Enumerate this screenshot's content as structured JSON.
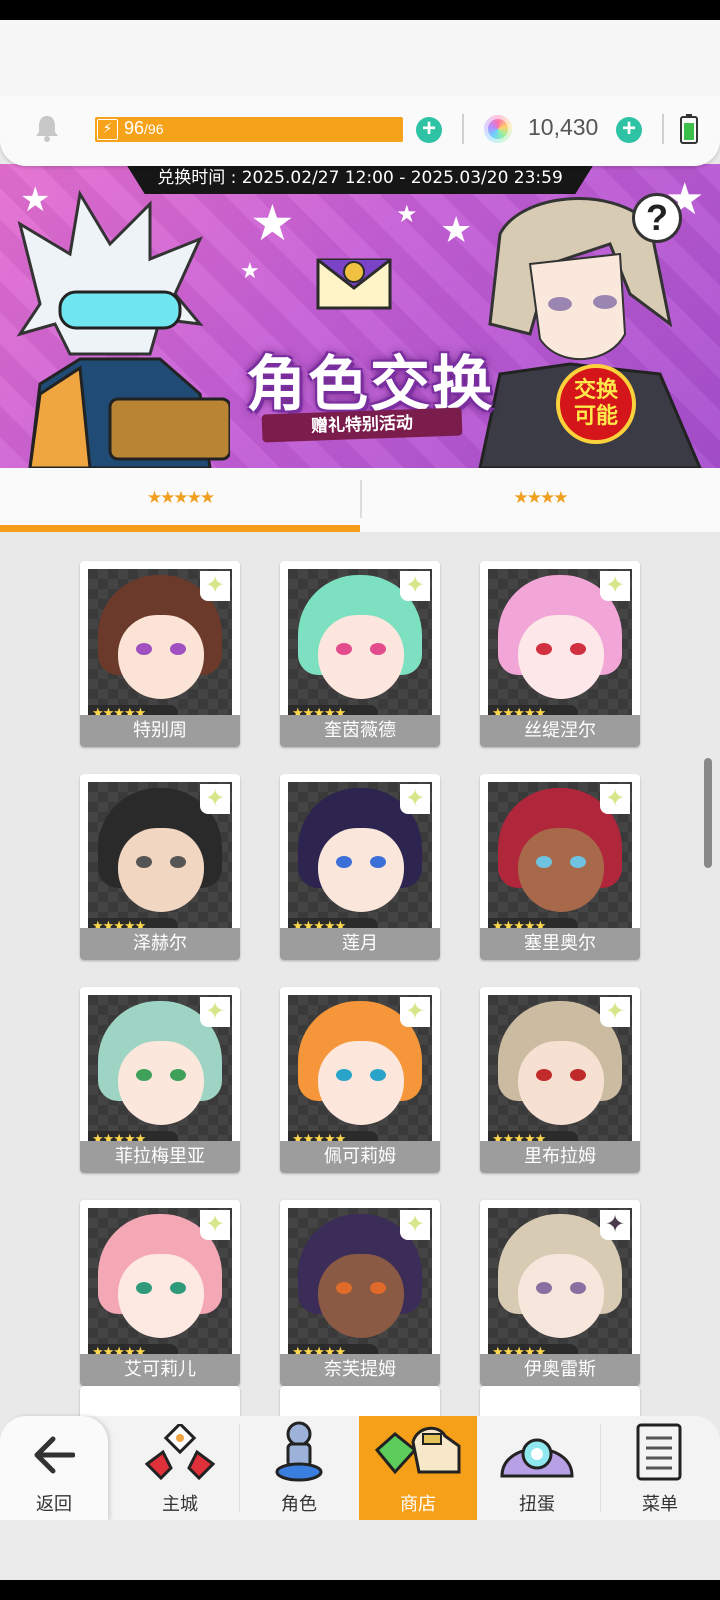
{
  "resources": {
    "energy_current": "96",
    "energy_max": "/96",
    "gems": "10,430",
    "plus": "+"
  },
  "banner": {
    "exchange_time": "兑换时间 : 2025.02/27 12:00 - 2025.03/20 23:59",
    "title": "角色交换",
    "subtitle": "赠礼特别活动",
    "badge_line1": "交换",
    "badge_line2": "可能",
    "help": "?"
  },
  "tabs": [
    {
      "label": "★★★★★",
      "active": true
    },
    {
      "label": "★★★★",
      "active": false
    }
  ],
  "characters": [
    {
      "name": "特别周",
      "stars": "★★★★★",
      "hair": "#6b3a2a",
      "face": "#fbe3d6",
      "eye": "#a050c0"
    },
    {
      "name": "奎茵薇德",
      "stars": "★★★★★",
      "hair": "#7de0c0",
      "face": "#fde6dd",
      "eye": "#e24c8c"
    },
    {
      "name": "丝缇涅尔",
      "stars": "★★★★★",
      "hair": "#f2a6d8",
      "face": "#fde7e8",
      "eye": "#d03040"
    },
    {
      "name": "泽赫尔",
      "stars": "★★★★★",
      "hair": "#2a2a2a",
      "face": "#f1d6c2",
      "eye": "#555555"
    },
    {
      "name": "莲月",
      "stars": "★★★★★",
      "hair": "#2d2550",
      "face": "#fbe6dc",
      "eye": "#3c6fd8"
    },
    {
      "name": "塞里奥尔",
      "stars": "★★★★★",
      "hair": "#b0263a",
      "face": "#a8684a",
      "eye": "#6fc3e0"
    },
    {
      "name": "菲拉梅里亚",
      "stars": "★★★★★",
      "hair": "#9dd4c4",
      "face": "#fbe7dc",
      "eye": "#3fa05a"
    },
    {
      "name": "佩可莉姆",
      "stars": "★★★★★",
      "hair": "#f5963a",
      "face": "#fde7dc",
      "eye": "#2aa3c8"
    },
    {
      "name": "里布拉姆",
      "stars": "★★★★★",
      "hair": "#cbbba0",
      "face": "#f6e0d2",
      "eye": "#c02a2a"
    },
    {
      "name": "艾可莉儿",
      "stars": "★★★★★",
      "hair": "#f4a7b4",
      "face": "#fde8e2",
      "eye": "#2f9a7a"
    },
    {
      "name": "奈芙提姆",
      "stars": "★★★★★",
      "hair": "#3b2c58",
      "face": "#8a5a44",
      "eye": "#e06a2a"
    },
    {
      "name": "伊奥雷斯",
      "stars": "★★★★★",
      "hair": "#d8cbb4",
      "face": "#f7e6dc",
      "eye": "#8a6fa0"
    }
  ],
  "nav": [
    {
      "label": "返回",
      "icon": "back-arrow-icon"
    },
    {
      "label": "主城",
      "icon": "castle-icon"
    },
    {
      "label": "角色",
      "icon": "character-icon"
    },
    {
      "label": "商店",
      "icon": "shop-icon",
      "active": true
    },
    {
      "label": "扭蛋",
      "icon": "gacha-icon"
    },
    {
      "label": "菜单",
      "icon": "menu-list-icon"
    }
  ],
  "colors": {
    "accent": "#f6a019",
    "plus_button": "#2fc3a5",
    "banner": "#c55fd6"
  }
}
